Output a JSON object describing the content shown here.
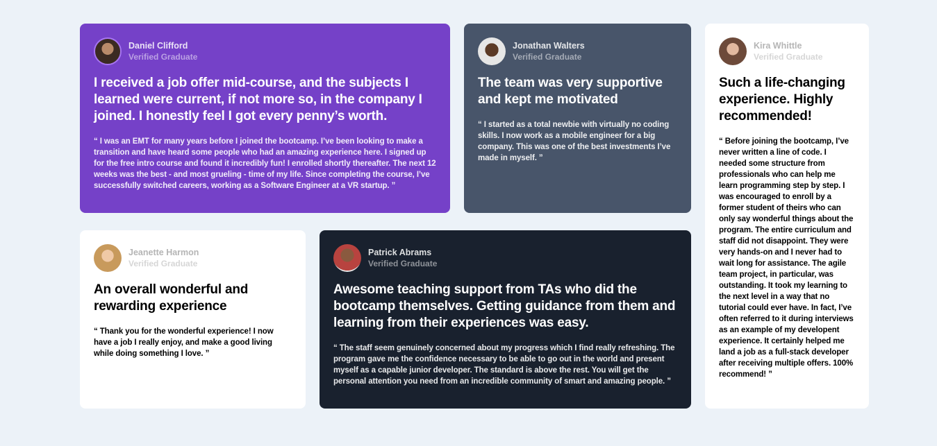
{
  "testimonials": [
    {
      "name": "Daniel Clifford",
      "role": "Verified Graduate",
      "headline": "I received a job offer mid-course, and the subjects I learned were current, if not more so, in the company I joined. I honestly feel I got every penny’s worth.",
      "quote": "“ I was an EMT for many years before I joined the bootcamp. I’ve been looking to make a transition and have heard some people who had an amazing experience here. I signed up for the free intro course and found it incredibly fun! I enrolled shortly thereafter. The next 12 weeks was the best - and most grueling - time of my life. Since completing the course, I’ve successfully switched careers, working as a Software Engineer at a VR startup. ”"
    },
    {
      "name": "Jonathan Walters",
      "role": "Verified Graduate",
      "headline": "The team was very supportive and kept me motivated",
      "quote": "“ I started as a total newbie with virtually no coding skills. I now work as a mobile engineer for a big company. This was one of the best investments I’ve made in myself. ”"
    },
    {
      "name": "Kira Whittle",
      "role": "Verified Graduate",
      "headline": "Such a life-changing experience. Highly recommended!",
      "quote": "“ Before joining the bootcamp, I’ve never written a line of code. I needed some structure from professionals who can help me learn programming step by step. I was encouraged to enroll by a former student of theirs who can only say wonderful things about the program. The entire curriculum and staff did not disappoint. They were very hands-on and I never had to wait long for assistance. The agile team project, in particular, was outstanding. It took my learning to the next level in a way that no tutorial could ever have. In fact, I’ve often referred to it during interviews as an example of my developent experience. It certainly helped me land a job as a full-stack developer after receiving multiple offers. 100% recommend! ”"
    },
    {
      "name": "Jeanette Harmon",
      "role": "Verified Graduate",
      "headline": "An overall wonderful and rewarding experience",
      "quote": "“ Thank you for the wonderful experience! I now have a job I really enjoy, and make a good living while doing something I love. ”"
    },
    {
      "name": "Patrick Abrams",
      "role": "Verified Graduate",
      "headline": "Awesome teaching support from TAs who did the bootcamp themselves. Getting guidance from them and learning from their experiences was easy.",
      "quote": "“ The staff seem genuinely concerned about my progress which I find really refreshing. The program gave me the confidence necessary to be able to go out in the world and present myself as a capable junior developer. The standard is above the rest. You will get the personal attention you need from an incredible community of smart and amazing people. ”"
    }
  ],
  "colors": {
    "background": "#ecf2f8",
    "purple": "#7541c8",
    "slate": "#48556a",
    "dark": "#19212e",
    "white": "#ffffff"
  }
}
